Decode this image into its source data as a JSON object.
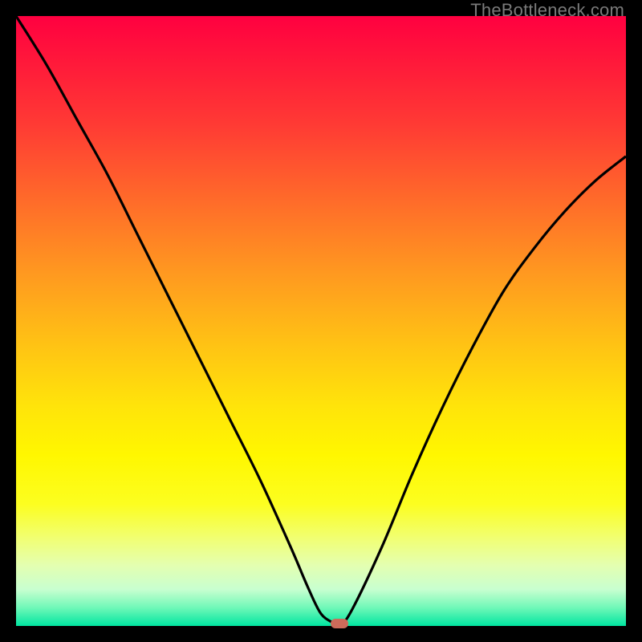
{
  "attribution": "TheBottleneck.com",
  "chart_data": {
    "type": "line",
    "title": "",
    "xlabel": "",
    "ylabel": "",
    "xlim": [
      0,
      100
    ],
    "ylim": [
      0,
      100
    ],
    "x": [
      0,
      5,
      10,
      15,
      20,
      25,
      30,
      35,
      40,
      45,
      48,
      50,
      52,
      53,
      55,
      60,
      65,
      70,
      75,
      80,
      85,
      90,
      95,
      100
    ],
    "values": [
      100,
      92,
      83,
      74,
      64,
      54,
      44,
      34,
      24,
      13,
      6,
      2,
      0.5,
      0,
      2.5,
      13,
      25,
      36,
      46,
      55,
      62,
      68,
      73,
      77
    ],
    "marker": {
      "x": 53,
      "y": 0
    },
    "colors": {
      "curve": "#000000",
      "marker": "#cc6b5a"
    }
  }
}
